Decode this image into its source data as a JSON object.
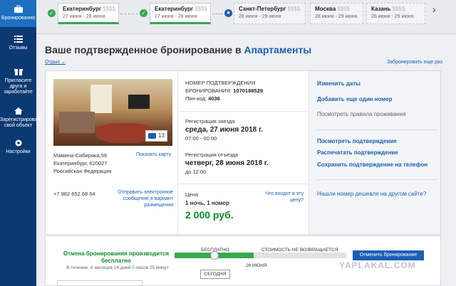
{
  "sidebar": {
    "items": [
      {
        "label": "Бронирования",
        "icon": "briefcase-icon"
      },
      {
        "label": "Отзывы",
        "icon": "list-icon"
      },
      {
        "label": "Пригласите друга и заработайте",
        "icon": "gift-icon"
      },
      {
        "label": "Зарегистрировать свой объект",
        "icon": "home-icon"
      },
      {
        "label": "Настройки",
        "icon": "gear-icon"
      }
    ]
  },
  "trips": [
    {
      "city": "Екатеринбург",
      "price": "$$$$",
      "dates": "27 июня - 28 июня"
    },
    {
      "city": "Екатеринбург",
      "price": "$$$$",
      "dates": "27 июня - 28 июня"
    },
    {
      "city": "Санкт-Петербург",
      "price": "$$$$",
      "dates": "28 июня - 29 июня"
    },
    {
      "city": "Москва",
      "price": "$$$$",
      "dates": "28 июня - 29 июня"
    },
    {
      "city": "Казань",
      "price": "$$$$",
      "dates": "28 июня - 29 июня"
    }
  ],
  "title_prefix": "Ваше подтвержденное бронирование в",
  "title_accent": "Апартаменты",
  "other_link": "Отдых",
  "archive_link": "Забронировать еще раз",
  "address": {
    "line1": "Мамина-Сибиряка,59",
    "line2": "Екатеринбург, 620027",
    "line3": "Российская Федерация"
  },
  "map_link": "Показать карту",
  "phone": "+7 982 652 68 64",
  "message_link": "Отправить электронное сообщение в вариант размещения",
  "photo_count": "13",
  "confirmation": {
    "label1": "НОМЕР ПОДТВЕРЖДЕНИЯ",
    "label2": "БРОНИРОВАНИЯ:",
    "number": "1070188529",
    "pin_label": "Пин-код:",
    "pin": "4036"
  },
  "checkin": {
    "label": "Регистрация заезда",
    "date": "среда, 27 июня 2018 г.",
    "time": "07:00 - 00:00"
  },
  "checkout": {
    "label": "Регистрация отъезда",
    "date": "четверг, 28 июня 2018 г.",
    "time": "до 12:00"
  },
  "price": {
    "label": "Цена",
    "nights": "1 ночь, 1 номер",
    "amount": "2 000 руб.",
    "whats_in": "Что входит в эту цену?"
  },
  "actions": {
    "change_dates": "Изменить даты",
    "add_room": "Добавить еще один номер",
    "rules": "Посмотреть правила проживания",
    "view_confirmation": "Посмотреть подтверждение",
    "print_confirmation": "Распечатать подтверждение",
    "save_phone": "Сохранить подтверждение на телефон",
    "cheaper": "Нашли номер дешевле на другом сайте?"
  },
  "cancellation": {
    "title": "Отмена бронирования производится бесплатно",
    "sub": "В течение: 6 месяцев 14 дней 0 часов 25 минут",
    "free_label": "БЕСПЛАТНО",
    "nonref_label": "СТОИМОСТЬ НЕ ВОЗВРАЩАЕТСЯ",
    "today": "СЕГОДНЯ",
    "date": "26 ИЮНЯ",
    "cancel_button": "Отменить бронирование"
  },
  "watermark": "YAPLAKAL.COM"
}
